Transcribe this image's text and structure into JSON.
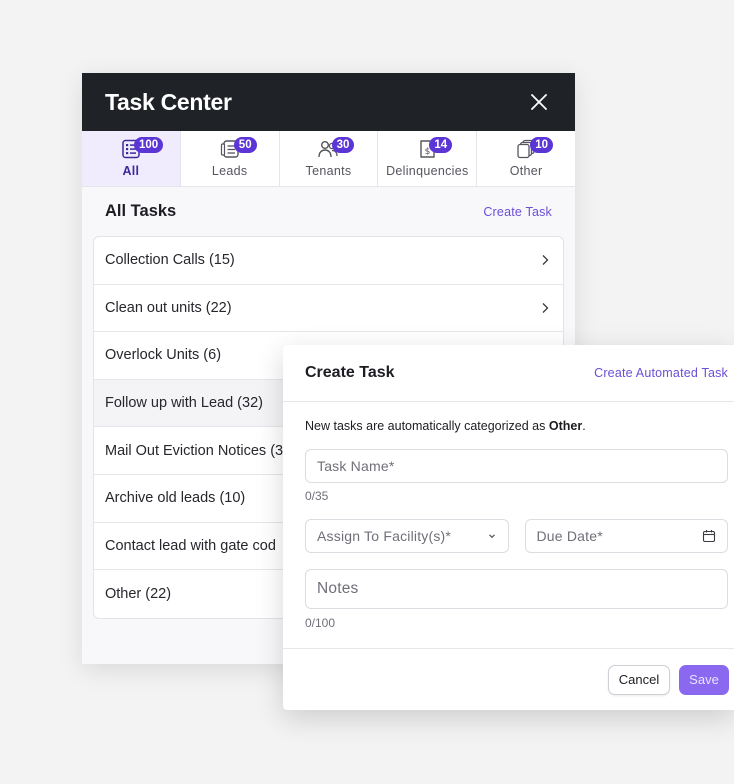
{
  "task_center": {
    "title": "Task Center",
    "tabs": [
      {
        "label": "All",
        "count": "100",
        "icon": "list-icon"
      },
      {
        "label": "Leads",
        "count": "50",
        "icon": "leads-icon"
      },
      {
        "label": "Tenants",
        "count": "30",
        "icon": "tenants-icon"
      },
      {
        "label": "Delinquencies",
        "count": "14",
        "icon": "dollar-doc-icon"
      },
      {
        "label": "Other",
        "count": "10",
        "icon": "stack-icon"
      }
    ],
    "section_title": "All Tasks",
    "create_task_link": "Create Task",
    "tasks": [
      {
        "label": "Collection Calls (15)"
      },
      {
        "label": "Clean out units (22)"
      },
      {
        "label": "Overlock Units (6)"
      },
      {
        "label": "Follow up with Lead (32)"
      },
      {
        "label": "Mail Out Eviction Notices (3"
      },
      {
        "label": "Archive old leads (10)"
      },
      {
        "label": "Contact lead with gate cod"
      },
      {
        "label": "Other (22)"
      }
    ]
  },
  "create_task": {
    "title": "Create Task",
    "automated_link": "Create Automated Task",
    "note_prefix": "New tasks are automatically categorized as ",
    "note_category": "Other",
    "note_suffix": ".",
    "task_name_placeholder": "Task Name*",
    "task_name_counter": "0/35",
    "facility_placeholder": "Assign To Facility(s)*",
    "due_date_placeholder": "Due Date*",
    "notes_placeholder": "Notes",
    "notes_counter": "0/100",
    "cancel_label": "Cancel",
    "save_label": "Save"
  },
  "colors": {
    "header_bg": "#1f2227",
    "accent": "#5b35d5",
    "link": "#6b4fd6",
    "save_button": "#8a68f0"
  }
}
